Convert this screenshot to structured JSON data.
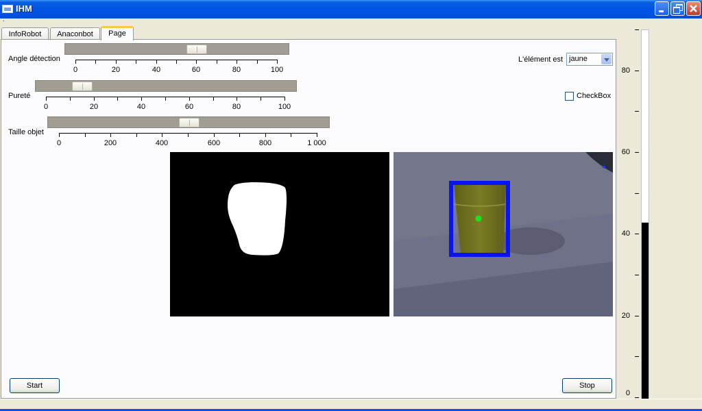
{
  "window": {
    "title": "IHM"
  },
  "menubar": {
    "text": "."
  },
  "tabs": [
    {
      "label": "InfoRobot"
    },
    {
      "label": "Anaconbot"
    },
    {
      "label": "Page"
    }
  ],
  "sliders": [
    {
      "label": "Angle détection",
      "value": 60,
      "min": 0,
      "max": 100,
      "tick_labels": [
        "0",
        "20",
        "40",
        "60",
        "80",
        "100"
      ]
    },
    {
      "label": "Pureté",
      "value": 15,
      "min": 0,
      "max": 100,
      "tick_labels": [
        "0",
        "20",
        "40",
        "60",
        "80",
        "100"
      ]
    },
    {
      "label": "Taille objet",
      "value": 500,
      "min": 0,
      "max": 1000,
      "tick_labels": [
        "0",
        "200",
        "400",
        "600",
        "800",
        "1 000"
      ]
    }
  ],
  "element": {
    "label": "L'élément est",
    "selected": "jaune"
  },
  "checkbox": {
    "label": "CheckBox",
    "checked": false
  },
  "buttons": {
    "start": "Start",
    "stop": "Stop"
  },
  "gauge": {
    "value": 43,
    "max": 90,
    "tick_labels": [
      "80",
      "60",
      "40",
      "20",
      "0"
    ]
  },
  "colors": {
    "detection_box": "#0a14f0",
    "detection_center": "#13e61e",
    "object": "#6f7020"
  }
}
